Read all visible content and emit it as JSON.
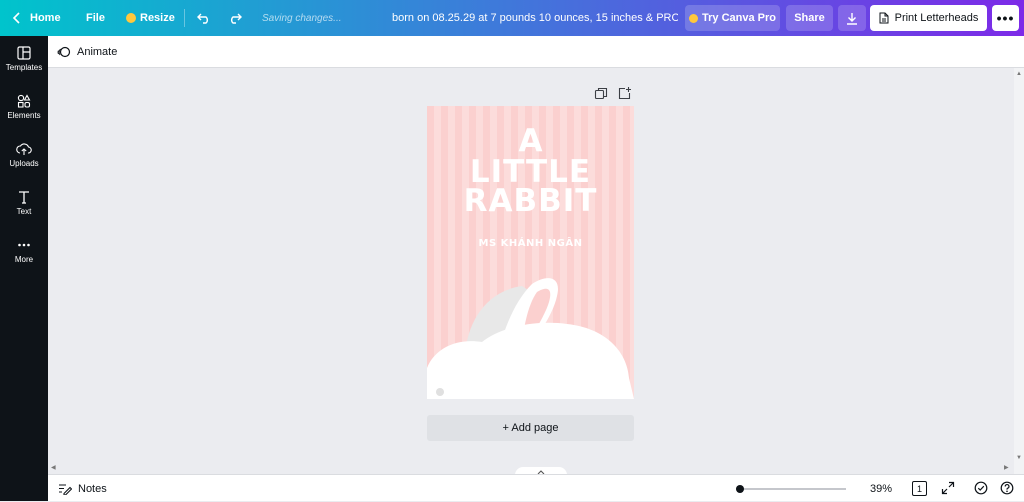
{
  "topbar": {
    "home_label": "Home",
    "file_label": "File",
    "resize_label": "Resize",
    "status_text": "Saving changes...",
    "doc_title": "born on 08.25.29 at 7 pounds 10 ounces, 15 inches & PROU...",
    "try_pro_label": "Try Canva Pro",
    "share_label": "Share",
    "print_label": "Print Letterheads"
  },
  "sidebar": {
    "items": [
      {
        "label": "Templates",
        "icon": "templates-icon"
      },
      {
        "label": "Elements",
        "icon": "elements-icon"
      },
      {
        "label": "Uploads",
        "icon": "uploads-icon"
      },
      {
        "label": "Text",
        "icon": "text-icon"
      },
      {
        "label": "More",
        "icon": "more-icon"
      }
    ]
  },
  "subbar": {
    "animate_label": "Animate"
  },
  "design": {
    "title_line1": "A",
    "title_line2": "LITTLE",
    "title_line3": "RABBIT",
    "subtitle": "MS KHÁNH NGÂN",
    "colors": {
      "stripe_a": "#fbd0cf",
      "stripe_b": "#fcdcdb",
      "rabbit": "#ffffff",
      "shadow": "#e8e8e8"
    }
  },
  "add_page_label": "+ Add page",
  "bottombar": {
    "notes_label": "Notes",
    "zoom": "39%",
    "page_count": "1"
  }
}
